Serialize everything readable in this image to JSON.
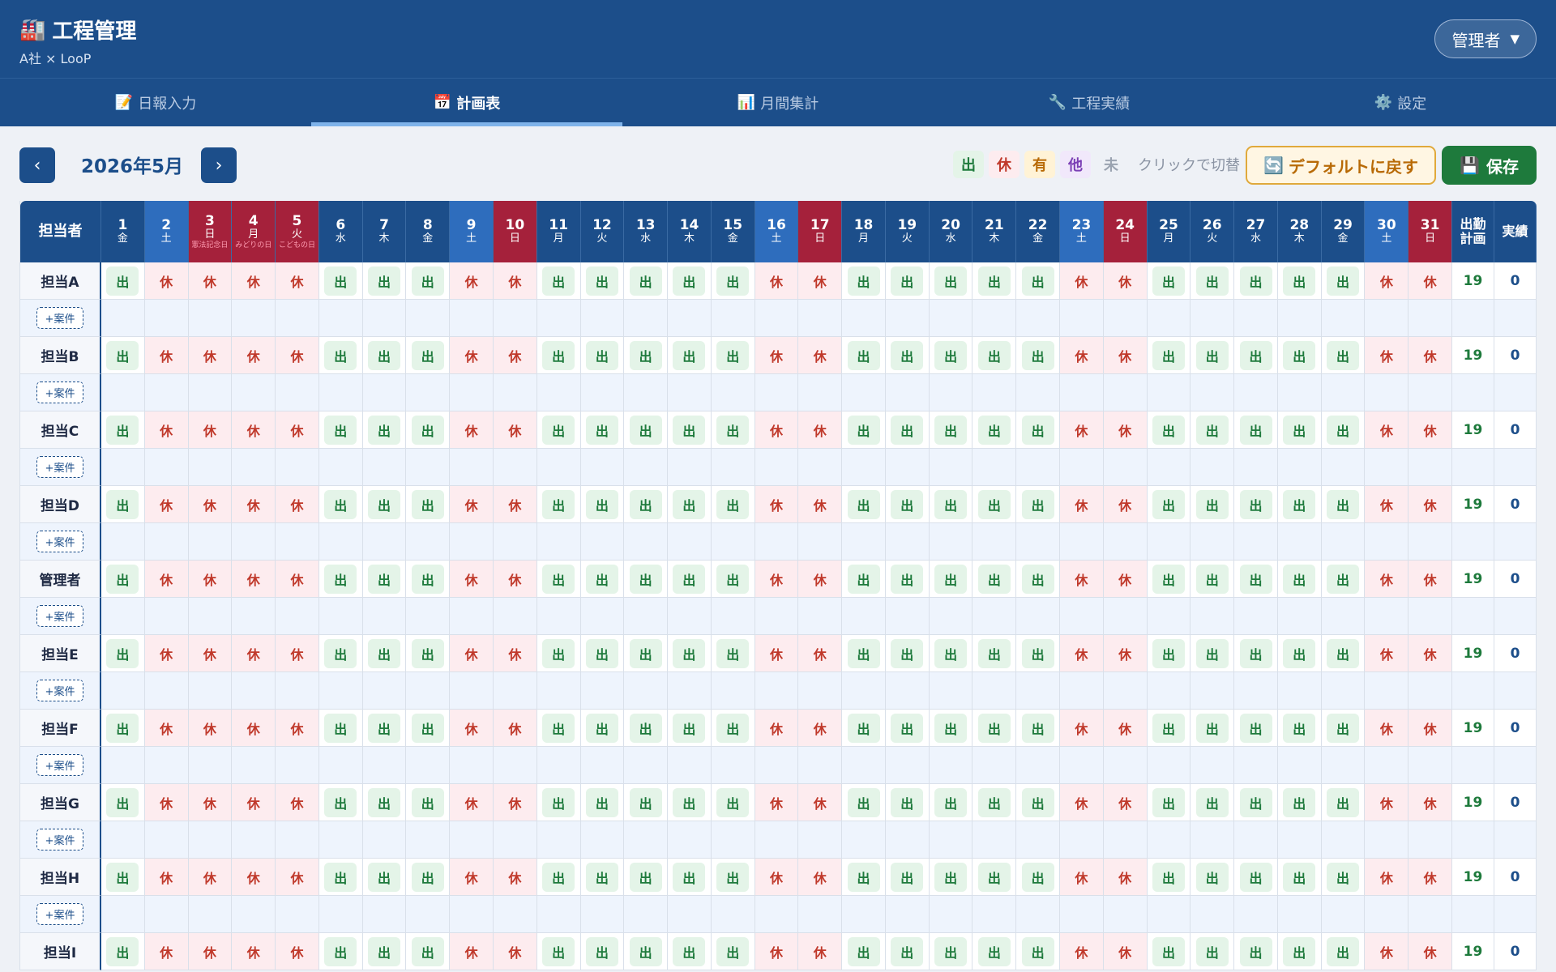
{
  "app": {
    "title": "工程管理",
    "subtitle": "A社 × LooP",
    "logo_icon": "factory-icon"
  },
  "user": {
    "name": "管理者",
    "caret": "▼"
  },
  "tabs": [
    {
      "icon": "📝",
      "label": "日報入力",
      "active": false
    },
    {
      "icon": "📅",
      "label": "計画表",
      "active": true
    },
    {
      "icon": "📊",
      "label": "月間集計",
      "active": false
    },
    {
      "icon": "🔧",
      "label": "工程実績",
      "active": false
    },
    {
      "icon": "⚙️",
      "label": "設定",
      "active": false
    }
  ],
  "toolbar": {
    "prev": "‹",
    "next": "›",
    "month": "2026年5月",
    "legend": [
      {
        "label": "出",
        "bg": "#e4f4e8",
        "fg": "#1e7a3c"
      },
      {
        "label": "休",
        "bg": "#fdecef",
        "fg": "#c0392b"
      },
      {
        "label": "有",
        "bg": "#fff3d6",
        "fg": "#b86a06"
      },
      {
        "label": "他",
        "bg": "#f1e8fb",
        "fg": "#7b3fb5"
      },
      {
        "label": "未",
        "bg": "transparent",
        "fg": "#9aa3b0"
      }
    ],
    "hint": "クリックで切替",
    "reset_label": "デフォルトに戻す",
    "save_label": "保存"
  },
  "table": {
    "corner": "担当者",
    "planned_header": "出勤\n計画",
    "actual_header": "実績",
    "add_case_label": "+案件",
    "days": [
      {
        "d": "1",
        "w": "金",
        "t": "wd"
      },
      {
        "d": "2",
        "w": "土",
        "t": "sat"
      },
      {
        "d": "3",
        "w": "日",
        "t": "sun",
        "hol": "憲法記念日"
      },
      {
        "d": "4",
        "w": "月",
        "t": "sun",
        "hol": "みどりの日"
      },
      {
        "d": "5",
        "w": "火",
        "t": "sun",
        "hol": "こどもの日"
      },
      {
        "d": "6",
        "w": "水",
        "t": "wd"
      },
      {
        "d": "7",
        "w": "木",
        "t": "wd"
      },
      {
        "d": "8",
        "w": "金",
        "t": "wd"
      },
      {
        "d": "9",
        "w": "土",
        "t": "sat"
      },
      {
        "d": "10",
        "w": "日",
        "t": "sun"
      },
      {
        "d": "11",
        "w": "月",
        "t": "wd"
      },
      {
        "d": "12",
        "w": "火",
        "t": "wd"
      },
      {
        "d": "13",
        "w": "水",
        "t": "wd"
      },
      {
        "d": "14",
        "w": "木",
        "t": "wd"
      },
      {
        "d": "15",
        "w": "金",
        "t": "wd"
      },
      {
        "d": "16",
        "w": "土",
        "t": "sat"
      },
      {
        "d": "17",
        "w": "日",
        "t": "sun"
      },
      {
        "d": "18",
        "w": "月",
        "t": "wd"
      },
      {
        "d": "19",
        "w": "火",
        "t": "wd"
      },
      {
        "d": "20",
        "w": "水",
        "t": "wd"
      },
      {
        "d": "21",
        "w": "木",
        "t": "wd"
      },
      {
        "d": "22",
        "w": "金",
        "t": "wd"
      },
      {
        "d": "23",
        "w": "土",
        "t": "sat"
      },
      {
        "d": "24",
        "w": "日",
        "t": "sun"
      },
      {
        "d": "25",
        "w": "月",
        "t": "wd"
      },
      {
        "d": "26",
        "w": "火",
        "t": "wd"
      },
      {
        "d": "27",
        "w": "水",
        "t": "wd"
      },
      {
        "d": "28",
        "w": "木",
        "t": "wd"
      },
      {
        "d": "29",
        "w": "金",
        "t": "wd"
      },
      {
        "d": "30",
        "w": "土",
        "t": "sat"
      },
      {
        "d": "31",
        "w": "日",
        "t": "sun"
      }
    ],
    "schedule_pattern": [
      "出",
      "休",
      "休",
      "休",
      "休",
      "出",
      "出",
      "出",
      "休",
      "休",
      "出",
      "出",
      "出",
      "出",
      "出",
      "休",
      "休",
      "出",
      "出",
      "出",
      "出",
      "出",
      "休",
      "休",
      "出",
      "出",
      "出",
      "出",
      "出",
      "休",
      "休"
    ],
    "staff": [
      {
        "name": "担当A",
        "planned": "19",
        "actual": "0"
      },
      {
        "name": "担当B",
        "planned": "19",
        "actual": "0"
      },
      {
        "name": "担当C",
        "planned": "19",
        "actual": "0"
      },
      {
        "name": "担当D",
        "planned": "19",
        "actual": "0"
      },
      {
        "name": "管理者",
        "planned": "19",
        "actual": "0"
      },
      {
        "name": "担当E",
        "planned": "19",
        "actual": "0"
      },
      {
        "name": "担当F",
        "planned": "19",
        "actual": "0"
      },
      {
        "name": "担当G",
        "planned": "19",
        "actual": "0"
      },
      {
        "name": "担当H",
        "planned": "19",
        "actual": "0"
      },
      {
        "name": "担当I",
        "planned": "19",
        "actual": "0"
      }
    ]
  }
}
